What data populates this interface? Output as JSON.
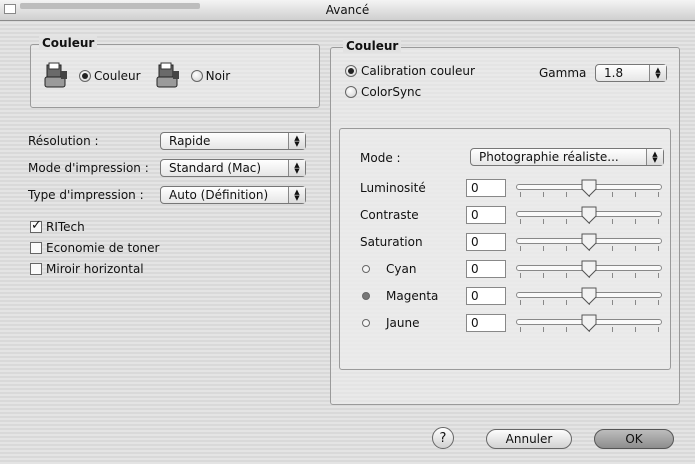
{
  "window": {
    "title": "Avancé"
  },
  "left_color": {
    "legend": "Couleur",
    "option_color": "Couleur",
    "option_black": "Noir",
    "selected": "Couleur"
  },
  "settings": {
    "resolution_label": "Résolution :",
    "resolution_value": "Rapide",
    "print_mode_label": "Mode d'impression :",
    "print_mode_value": "Standard (Mac)",
    "print_type_label": "Type d'impression :",
    "print_type_value": "Auto (Définition)"
  },
  "checkboxes": [
    {
      "label": "RITech",
      "checked": true
    },
    {
      "label": "Economie de toner",
      "checked": false
    },
    {
      "label": "Miroir horizontal",
      "checked": false
    }
  ],
  "right_color": {
    "legend": "Couleur",
    "calibration_label": "Calibration couleur",
    "colorsync_label": "ColorSync",
    "selected": "Calibration couleur",
    "gamma_label": "Gamma",
    "gamma_value": "1.8"
  },
  "adjust": {
    "mode_label": "Mode :",
    "mode_value": "Photographie réaliste...",
    "sliders": [
      {
        "label": "Luminosité",
        "value": "0",
        "level": 0.5
      },
      {
        "label": "Contraste",
        "value": "0",
        "level": 0.5
      },
      {
        "label": "Saturation",
        "value": "0",
        "level": 0.5
      },
      {
        "label": "Cyan",
        "value": "0",
        "level": 0.5,
        "dot": "cyan"
      },
      {
        "label": "Magenta",
        "value": "0",
        "level": 0.5,
        "dot": "magenta"
      },
      {
        "label": "Jaune",
        "value": "0",
        "level": 0.5,
        "dot": "jaune"
      }
    ]
  },
  "buttons": {
    "help": "?",
    "cancel": "Annuler",
    "ok": "OK"
  }
}
